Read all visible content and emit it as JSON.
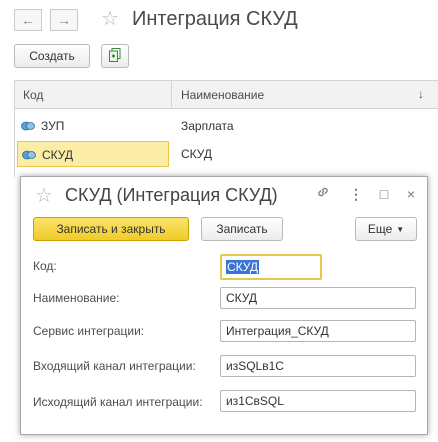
{
  "header": {
    "title": "Интеграция СКУД",
    "back_icon": "←",
    "forward_icon": "→",
    "star_icon": "☆"
  },
  "toolbar": {
    "create_label": "Создать"
  },
  "list": {
    "columns": [
      "Код",
      "Наименование"
    ],
    "sort_icon": "↓",
    "rows": [
      {
        "code": "ЗУП",
        "name": "Зарплата",
        "selected": false
      },
      {
        "code": "СКУД",
        "name": "СКУД",
        "selected": true
      }
    ]
  },
  "form": {
    "title": "СКУД (Интеграция СКУД)",
    "star_icon": "☆",
    "link_icon": "🔗",
    "more_icon": "⋮",
    "maximize_icon": "□",
    "close_icon": "×",
    "save_close_label": "Записать и закрыть",
    "save_label": "Записать",
    "more_label": "Еще",
    "fields": {
      "code_label": "Код:",
      "code_value": "СКУД",
      "name_label": "Наименование:",
      "name_value": "СКУД",
      "service_label": "Сервис интеграции:",
      "service_value": "Интеграция_СКУД",
      "in_label": "Входящий канал интеграции:",
      "in_value": "изSQLв1С",
      "out_label": "Исходящий канал интеграции:",
      "out_value": "из1СвSQL"
    }
  },
  "colors": {
    "accent_yellow": "#f0cb28",
    "selection_row": "#fbeda5",
    "text_selection": "#3875d7",
    "item_icon": "#4a8fc4"
  }
}
